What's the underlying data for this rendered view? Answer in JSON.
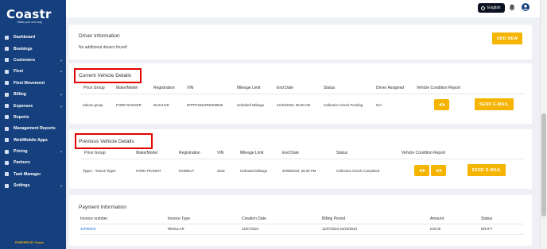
{
  "brand": {
    "name": "Coastr",
    "tagline": "Make your own way",
    "powered_by": "POWERED BY Coastr"
  },
  "sidebar": {
    "items": [
      {
        "label": "Dashboard",
        "icon": "dashboard-icon",
        "chevron": false
      },
      {
        "label": "Bookings",
        "icon": "bookings-icon",
        "chevron": false
      },
      {
        "label": "Customers",
        "icon": "customers-icon",
        "chevron": true
      },
      {
        "label": "Fleet",
        "icon": "car-icon",
        "chevron": true
      },
      {
        "label": "Fleet Movement",
        "icon": "fleet-movement-icon",
        "chevron": false
      },
      {
        "label": "Billing",
        "icon": "billing-icon",
        "chevron": true
      },
      {
        "label": "Expenses",
        "icon": "expenses-icon",
        "chevron": true
      },
      {
        "label": "Reports",
        "icon": "reports-icon",
        "chevron": false
      },
      {
        "label": "Management Reports",
        "icon": "management-reports-icon",
        "chevron": false
      },
      {
        "label": "Web/Mobile Apps",
        "icon": "apps-icon",
        "chevron": false
      },
      {
        "label": "Pricing",
        "icon": "pricing-icon",
        "chevron": true
      },
      {
        "label": "Partners",
        "icon": "partners-icon",
        "chevron": false
      },
      {
        "label": "Task Manager",
        "icon": "task-icon",
        "chevron": false
      },
      {
        "label": "Settings",
        "icon": "gear-icon",
        "chevron": true
      }
    ],
    "chevron_glyph": "⌄"
  },
  "topbar": {
    "language": "English"
  },
  "driver_info": {
    "title": "Driver Information",
    "empty_text": "No additional drivers found!",
    "add_button": "ADD NEW"
  },
  "current_vehicle": {
    "title": "Current Vehicle Details",
    "headers": [
      "Price Group",
      "Make/Model",
      "Registration",
      "VIN",
      "Mileage Limit",
      "End Date",
      "Status",
      "Driver Assigned",
      "Vehicle Condition Report"
    ],
    "row": {
      "price_group": "Saloon group",
      "make_model": "FORD RANGER",
      "registration": "ML21HVD",
      "vin": "6FPPXXMJ2PMJ59546",
      "mileage_limit": "Unlimited Mileage",
      "end_date": "24/10/2024, 06:30 AM",
      "status": "Collection Check Pending",
      "driver_assigned": "N/A",
      "send_button": "SEND E-MAIL"
    }
  },
  "previous_vehicle": {
    "title": "Previous Vehicle Details",
    "headers": [
      "Price Group",
      "Make/Model",
      "Registration",
      "VIN",
      "Mileage Limit",
      "End Date",
      "Status",
      "Vehicle Condition Report"
    ],
    "row": {
      "price_group": "Tipper - Transit Tipper",
      "make_model": "FORD TRANSIT",
      "registration": "EX69EUY",
      "vin": "4543",
      "mileage_limit": "Unlimited Mileage",
      "end_date": "20/08/2024, 05:30 PM",
      "status": "Collection Check Completed",
      "send_button": "SEND E-MAIL"
    }
  },
  "payment_info": {
    "title": "Payment Information",
    "headers": [
      "Invoice number",
      "Invoice Type",
      "Creation Date",
      "Billing Period",
      "Amount",
      "Status"
    ],
    "row": {
      "invoice_number": "43P8WK6",
      "invoice_type": "REGULAR",
      "creation_date": "11/07/2024",
      "billing_period": "11/07/2024-24/10/2024",
      "amount": "£40.00",
      "status": "DRAFT"
    }
  },
  "colors": {
    "sidebar": "#16407d",
    "accent": "#f4b400",
    "highlight": "#e60000",
    "link": "#1a73e8"
  }
}
